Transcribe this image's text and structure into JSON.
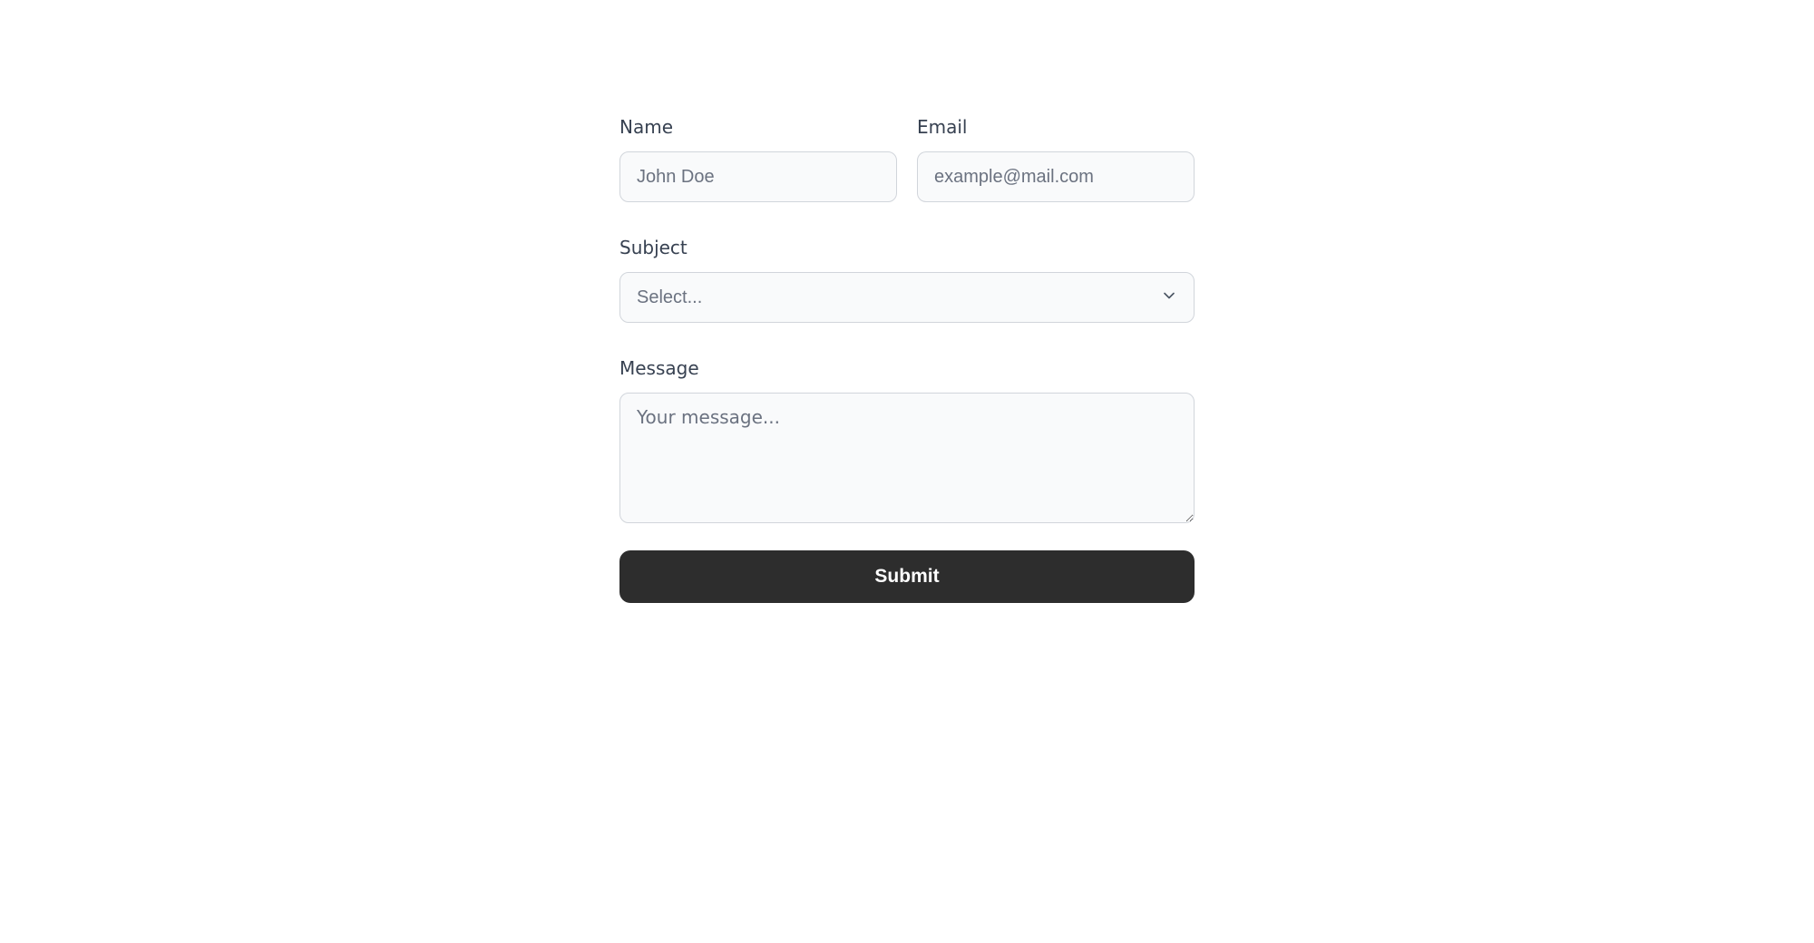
{
  "form": {
    "name": {
      "label": "Name",
      "placeholder": "John Doe"
    },
    "email": {
      "label": "Email",
      "placeholder": "example@mail.com"
    },
    "subject": {
      "label": "Subject",
      "placeholder": "Select..."
    },
    "message": {
      "label": "Message",
      "placeholder": "Your message..."
    },
    "submit_label": "Submit"
  }
}
